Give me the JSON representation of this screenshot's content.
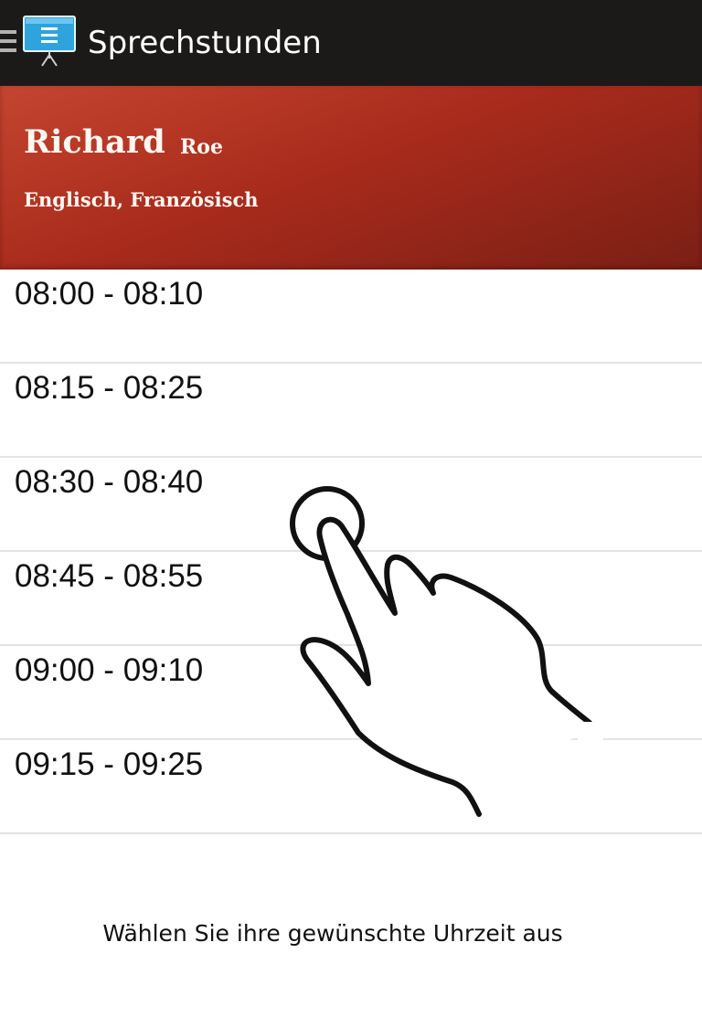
{
  "actionbar": {
    "icons": {
      "menu": "menu-icon",
      "app": "presentation-board-icon"
    },
    "title": "Sprechstunden"
  },
  "teacher": {
    "first_name": "Richard",
    "last_name": "Roe",
    "subjects": "Englisch, Französisch"
  },
  "slots": [
    {
      "time": "08:00 - 08:10"
    },
    {
      "time": "08:15 - 08:25"
    },
    {
      "time": "08:30 - 08:40"
    },
    {
      "time": "08:45 - 08:55"
    },
    {
      "time": "09:00 - 09:10"
    },
    {
      "time": "09:15 - 09:25"
    }
  ],
  "overlay": {
    "icon": "tap-gesture-icon",
    "instruction": "Wählen Sie ihre gewünschte Uhrzeit aus"
  },
  "colors": {
    "actionbar_bg": "#1c1a19",
    "header_red": "#a92b1c",
    "app_icon_blue": "#2ea3dc"
  }
}
